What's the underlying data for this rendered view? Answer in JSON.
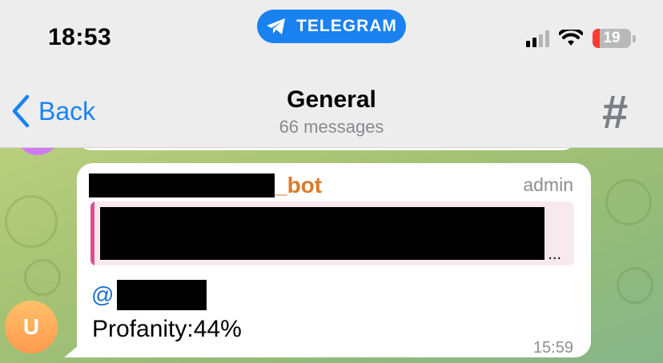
{
  "status_bar": {
    "time": "18:53",
    "app_pill": "TELEGRAM",
    "battery_level": "19",
    "signal_bars": 2,
    "colors": {
      "pill": "#1a82f0",
      "battery_low": "#ff3b30"
    }
  },
  "header": {
    "back_label": "Back",
    "title": "General",
    "subtitle": "66 messages",
    "topic_icon": "hashtag-icon"
  },
  "message": {
    "sender_suffix": "_bot",
    "role": "admin",
    "quote_more": "...",
    "mention_prefix": "@",
    "text": "Profanity:44%",
    "time": "15:59",
    "avatar_initial": "U",
    "colors": {
      "sender": "#d97a2b",
      "mention": "#1c6ec9",
      "quote_bar": "#d84f8f"
    }
  }
}
